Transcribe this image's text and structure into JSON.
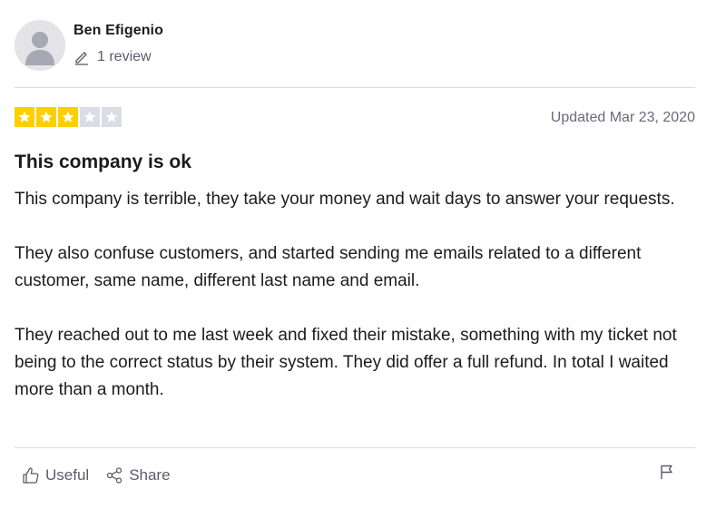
{
  "reviewer": {
    "name": "Ben Efigenio",
    "review_count": "1 review",
    "avatar_icon": "person-silhouette-icon"
  },
  "review": {
    "rating": 3,
    "rating_max": 5,
    "star_color_on": "#ffce00",
    "star_color_off": "#dcdce6",
    "updated": "Updated Mar 23, 2020",
    "title": "This company is ok",
    "paragraphs": [
      "This company is terrible, they take your money and wait days to answer your requests.",
      "They also confuse customers, and started sending me emails related to a different customer, same name, different last name and email.",
      "They reached out to me last week and fixed their mistake, something with my ticket not being to the correct status by their system. They did offer a full refund. In total I waited more than a month."
    ]
  },
  "actions": {
    "useful_label": "Useful",
    "share_label": "Share",
    "useful_icon": "thumbs-up-icon",
    "share_icon": "share-icon",
    "flag_icon": "flag-icon"
  }
}
